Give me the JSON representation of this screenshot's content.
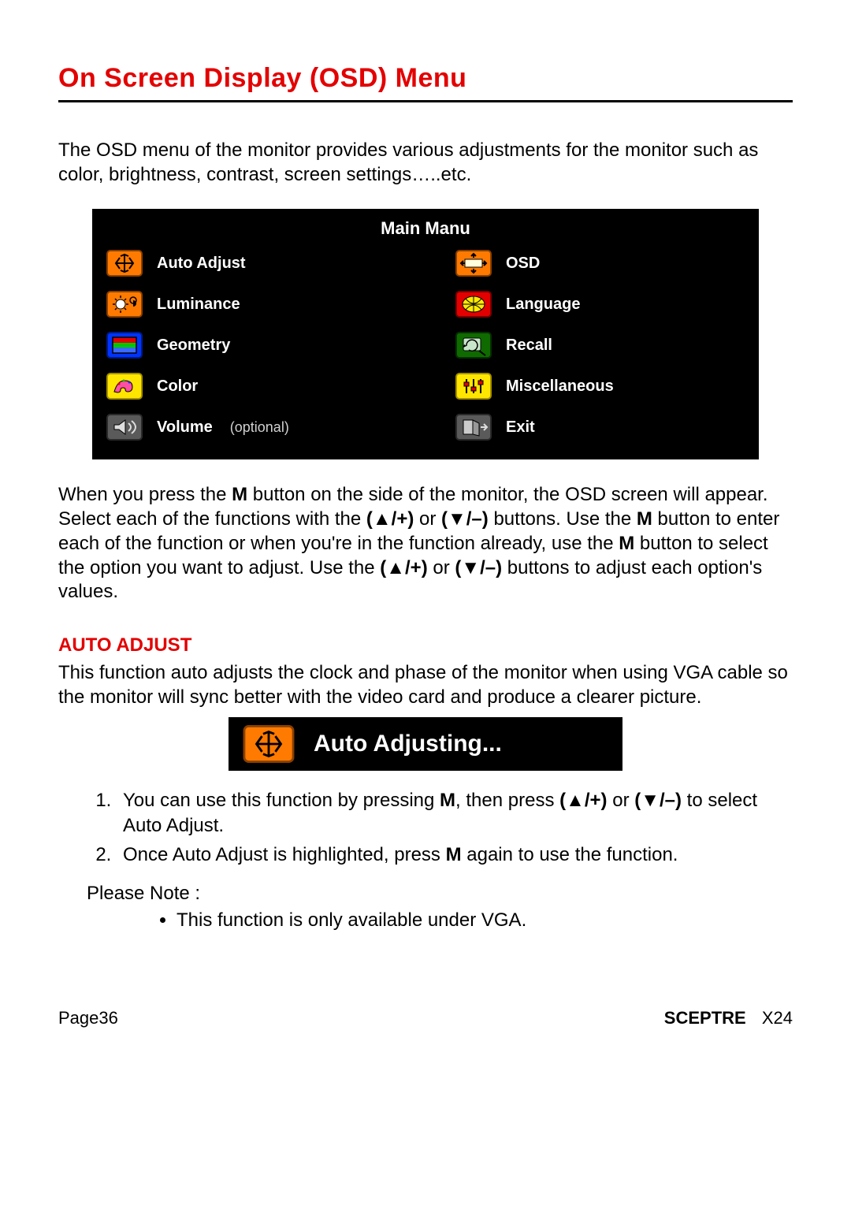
{
  "title": "On Screen Display (OSD) Menu",
  "intro": "The OSD menu of the monitor provides various adjustments for the monitor such as color, brightness, contrast, screen settings…..etc.",
  "osd": {
    "header": "Main Manu",
    "items": [
      {
        "label": "Auto Adjust",
        "suffix": "",
        "icon": "auto-adjust-icon",
        "bg": "#ff7a00"
      },
      {
        "label": "OSD",
        "suffix": "",
        "icon": "osd-icon",
        "bg": "#ff7a00"
      },
      {
        "label": "Luminance",
        "suffix": "",
        "icon": "luminance-icon",
        "bg": "#ff7a00"
      },
      {
        "label": "Language",
        "suffix": "",
        "icon": "language-icon",
        "bg": "#e30000"
      },
      {
        "label": "Geometry",
        "suffix": "",
        "icon": "geometry-icon",
        "bg": "#0033ff"
      },
      {
        "label": "Recall",
        "suffix": "",
        "icon": "recall-icon",
        "bg": "#0f6a00"
      },
      {
        "label": "Color",
        "suffix": "",
        "icon": "color-icon",
        "bg": "#ffe600"
      },
      {
        "label": "Miscellaneous",
        "suffix": "",
        "icon": "misc-icon",
        "bg": "#ffe600"
      },
      {
        "label": "Volume",
        "suffix": "(optional)",
        "icon": "volume-icon",
        "bg": "#5a5a5a"
      },
      {
        "label": "Exit",
        "suffix": "",
        "icon": "exit-icon",
        "bg": "#5a5a5a"
      }
    ]
  },
  "instructions": {
    "p1_a": "When you press the ",
    "p1_b": " button on the side of the monitor, the OSD screen will appear. Select each of the functions with the ",
    "p1_c": " or ",
    "p1_d": " buttons. Use the ",
    "p1_e": " button to enter each of the function or when you're in the function already, use the ",
    "p1_f": " button to select the option you want to adjust. Use the ",
    "p1_g": " or ",
    "p1_h": " buttons to adjust each option's values.",
    "M": "M",
    "up": "(▲/+)",
    "down": "(▼/–)"
  },
  "auto_adjust": {
    "heading": "AUTO ADJUST",
    "desc": "This function auto adjusts the clock and phase of the monitor when using VGA cable so the monitor will sync better with the video card and produce a clearer picture.",
    "banner": "Auto Adjusting...",
    "steps": {
      "s1_a": "You can use this function by pressing ",
      "s1_b": ", then press ",
      "s1_c": " or ",
      "s1_d": " to select Auto Adjust.",
      "s2_a": "Once Auto Adjust is highlighted, press ",
      "s2_b": " again to use the function."
    },
    "note_label": "Please Note :",
    "note_item": "This function is only available under VGA."
  },
  "footer": {
    "page": "Page36",
    "brand": "SCEPTRE",
    "model": "X24"
  }
}
